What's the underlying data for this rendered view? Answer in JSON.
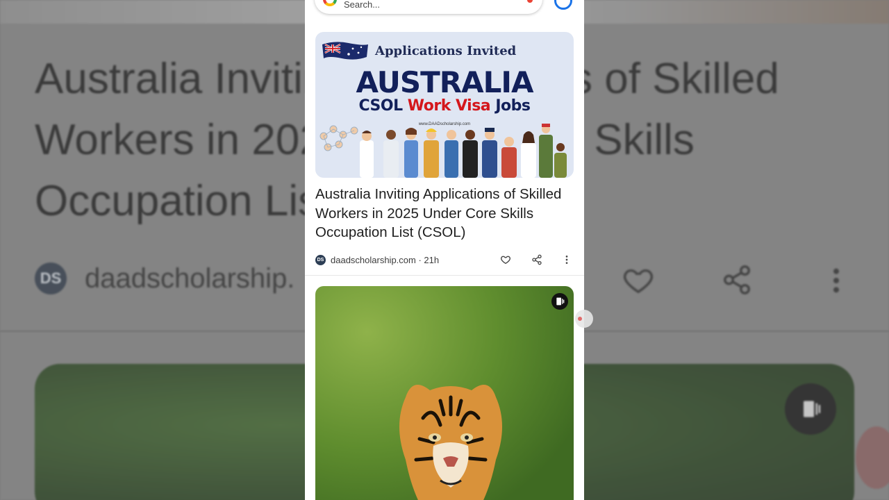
{
  "background": {
    "title": "Australia Inviting Applications of Skilled Workers in 2025 Under Core Skills Occupation List (CSOL)",
    "source_logo": "DS",
    "source": "daadscholarship."
  },
  "search": {
    "placeholder": "Search..."
  },
  "article": {
    "image": {
      "badge": "Applications Invited",
      "country": "AUSTRALIA",
      "line_csol": "CSOL",
      "line_work_visa": "Work Visa",
      "line_jobs": "Jobs",
      "site": "www.DAADscholarship.com"
    },
    "headline": "Australia Inviting Applications of Skilled Workers in 2025 Under Core Skills Occupation List (CSOL)",
    "source_logo": "DS",
    "source_meta": "daadscholarship.com · 21h"
  },
  "icons": {
    "search": "google-g-icon",
    "mic": "mic-icon",
    "account": "account-icon",
    "like": "heart-icon",
    "share": "share-icon",
    "more": "more-vert-icon",
    "reel": "short-video-icon"
  },
  "colors": {
    "navy": "#12205a",
    "red": "#d4171c",
    "card_bg": "#dfe6f3"
  }
}
